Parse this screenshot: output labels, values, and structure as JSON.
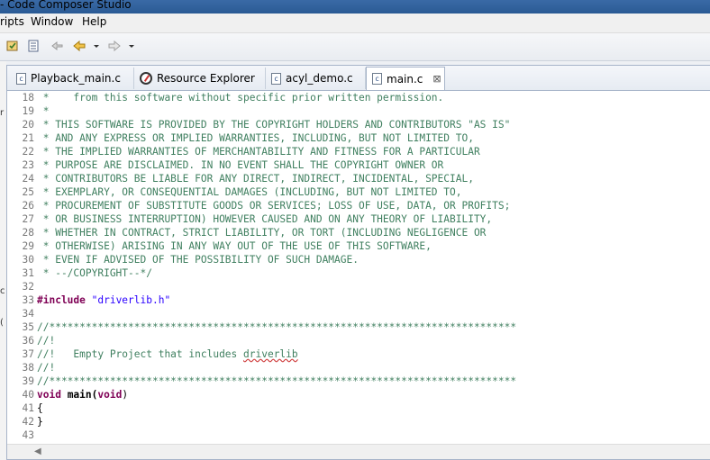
{
  "window": {
    "title": "- Code Composer Studio"
  },
  "menus": [
    "ripts",
    "Window",
    "Help"
  ],
  "tabs": [
    {
      "label": "Playback_main.c",
      "icon": "c-file-icon"
    },
    {
      "label": "Resource Explorer",
      "icon": "globe-icon"
    },
    {
      "label": "acyl_demo.c",
      "icon": "c-file-icon"
    },
    {
      "label": "main.c",
      "icon": "c-file-icon",
      "active": true,
      "close": "⊠"
    }
  ],
  "editor": {
    "lines": [
      {
        "n": "18",
        "text": " *    from this software without specific prior written permission."
      },
      {
        "n": "19",
        "text": " *"
      },
      {
        "n": "20",
        "text": " * THIS SOFTWARE IS PROVIDED BY THE COPYRIGHT HOLDERS AND CONTRIBUTORS \"AS IS\""
      },
      {
        "n": "21",
        "text": " * AND ANY EXPRESS OR IMPLIED WARRANTIES, INCLUDING, BUT NOT LIMITED TO,"
      },
      {
        "n": "22",
        "text": " * THE IMPLIED WARRANTIES OF MERCHANTABILITY AND FITNESS FOR A PARTICULAR"
      },
      {
        "n": "23",
        "text": " * PURPOSE ARE DISCLAIMED. IN NO EVENT SHALL THE COPYRIGHT OWNER OR"
      },
      {
        "n": "24",
        "text": " * CONTRIBUTORS BE LIABLE FOR ANY DIRECT, INDIRECT, INCIDENTAL, SPECIAL,"
      },
      {
        "n": "25",
        "text": " * EXEMPLARY, OR CONSEQUENTIAL DAMAGES (INCLUDING, BUT NOT LIMITED TO,"
      },
      {
        "n": "26",
        "text": " * PROCUREMENT OF SUBSTITUTE GOODS OR SERVICES; LOSS OF USE, DATA, OR PROFITS;"
      },
      {
        "n": "27",
        "text": " * OR BUSINESS INTERRUPTION) HOWEVER CAUSED AND ON ANY THEORY OF LIABILITY,"
      },
      {
        "n": "28",
        "text": " * WHETHER IN CONTRACT, STRICT LIABILITY, OR TORT (INCLUDING NEGLIGENCE OR"
      },
      {
        "n": "29",
        "text": " * OTHERWISE) ARISING IN ANY WAY OUT OF THE USE OF THIS SOFTWARE,"
      },
      {
        "n": "30",
        "text": " * EVEN IF ADVISED OF THE POSSIBILITY OF SUCH DAMAGE."
      },
      {
        "n": "31",
        "text": " * --/COPYRIGHT--*/"
      },
      {
        "n": "32",
        "text": ""
      },
      {
        "n": "33",
        "kind": "include",
        "kw": "#include",
        "str": " \"driverlib.h\""
      },
      {
        "n": "34",
        "text": ""
      },
      {
        "n": "35",
        "text": "//*****************************************************************************"
      },
      {
        "n": "36",
        "text": "//!"
      },
      {
        "n": "37",
        "kind": "comment-squig",
        "pre": "//!   Empty Project that includes ",
        "squig": "driverlib"
      },
      {
        "n": "38",
        "text": "//!"
      },
      {
        "n": "39",
        "text": "//*****************************************************************************"
      },
      {
        "n": "40",
        "kind": "main",
        "kw": "void",
        "rest": " main(",
        "kw2": "void",
        "end": ")"
      },
      {
        "n": "41",
        "kind": "code",
        "text": "{"
      },
      {
        "n": "42",
        "kind": "code",
        "text": "}"
      },
      {
        "n": "43",
        "kind": "code",
        "text": ""
      }
    ]
  }
}
